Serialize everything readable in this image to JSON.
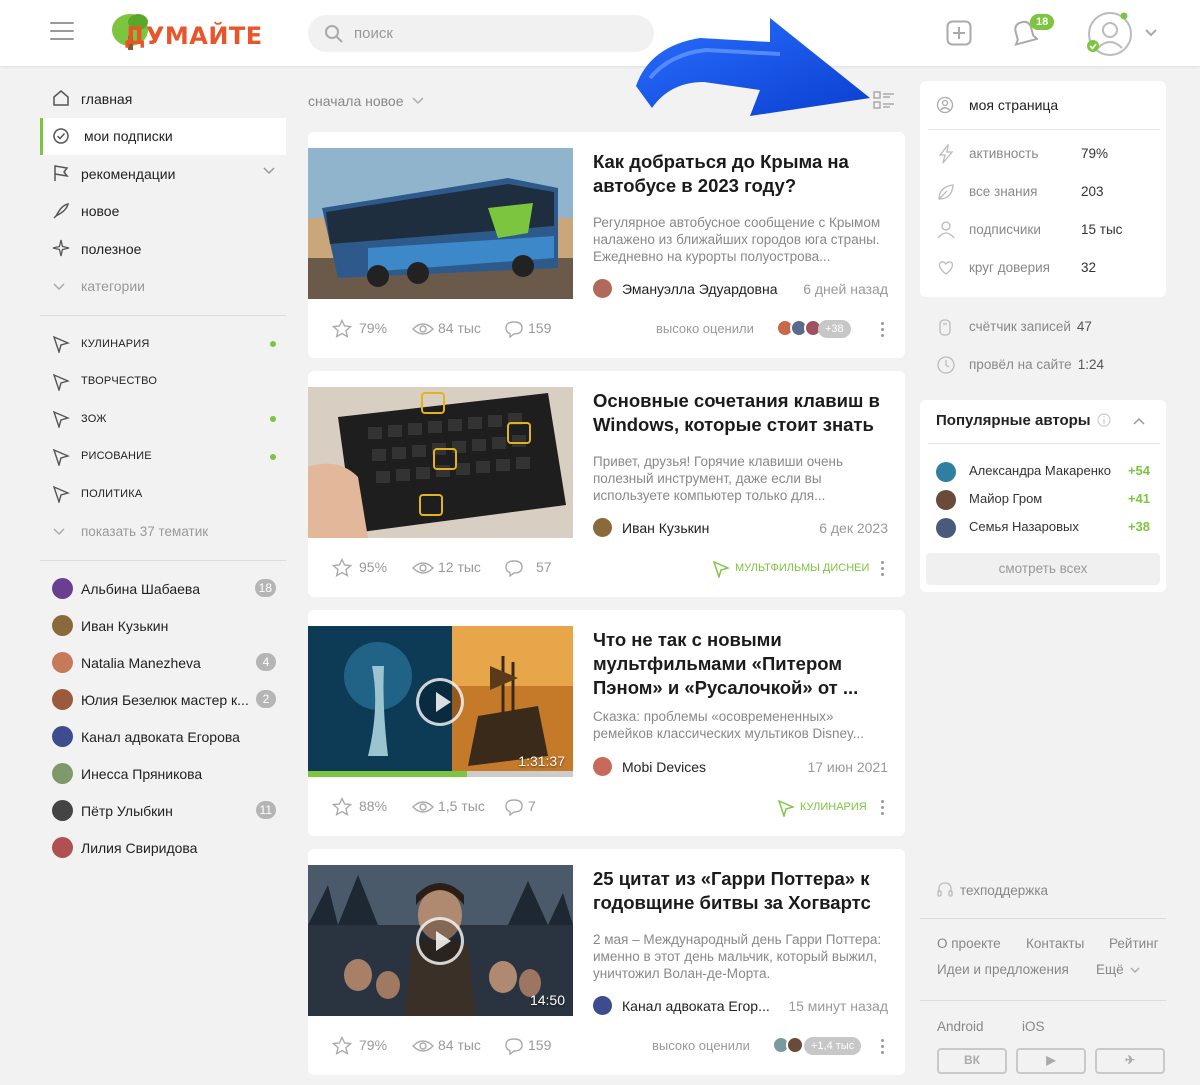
{
  "header": {
    "logo_text": "ДУМАЙТЕ",
    "search_placeholder": "поиск",
    "notifications_count": "18"
  },
  "feed": {
    "sort_label": "сначала новое"
  },
  "sidebar": {
    "nav": [
      {
        "label": "главная",
        "icon": "home-icon"
      },
      {
        "label": "мои подписки",
        "icon": "check-circle-icon"
      },
      {
        "label": "рекомендации",
        "icon": "flag-icon"
      },
      {
        "label": "новое",
        "icon": "rocket-icon"
      },
      {
        "label": "полезное",
        "icon": "sparkle-icon"
      },
      {
        "label": "категории",
        "icon": "chevron-down-icon"
      }
    ],
    "topics": [
      {
        "label": "кулинария",
        "dot": true
      },
      {
        "label": "творчество",
        "dot": false
      },
      {
        "label": "зож",
        "dot": true
      },
      {
        "label": "рисование",
        "dot": true
      },
      {
        "label": "политика",
        "dot": false
      }
    ],
    "show_topics": "показать 37 тематик",
    "subscriptions": [
      {
        "name": "Альбина Шабаева",
        "count": "18",
        "color": "#6b3f8f"
      },
      {
        "name": "Иван Кузькин",
        "count": "",
        "color": "#8a6a3a"
      },
      {
        "name": "Natalia Manezheva",
        "count": "4",
        "color": "#c77a5a"
      },
      {
        "name": "Юлия Безелюк мастер к...",
        "count": "2",
        "color": "#9b5a3c"
      },
      {
        "name": "Канал адвоката Егорова",
        "count": "",
        "color": "#3c4c8f"
      },
      {
        "name": "Инесса Пряникова",
        "count": "",
        "color": "#7f9a6a"
      },
      {
        "name": "Пётр Улыбкин",
        "count": "11",
        "color": "#444444"
      },
      {
        "name": "Лилия Свиридова",
        "count": "",
        "color": "#b05050"
      }
    ]
  },
  "cards": [
    {
      "title": "Как добраться до Крыма на автобусе в 2023 году?",
      "excerpt": "Регулярное автобусное сообщение с Крымом налажено из ближайших городов юга страны. Ежедневно на курорты полуострова...",
      "author": "Эмануэлла Эдуардовна",
      "time": "6 дней назад",
      "rating": "79%",
      "views": "84 тыс",
      "comments": "159",
      "rated_label": "высоко оценили",
      "rated_more": "+38",
      "tag": ""
    },
    {
      "title": "Основные сочетания клавиш в Windows, которые стоит знать",
      "excerpt": "Привет, друзья! Горячие клавиши очень полезный инструмент, даже если вы используете компьютер только для...",
      "author": "Иван Кузькин",
      "time": "6 дек 2023",
      "rating": "95%",
      "views": "12 тыс",
      "comments": "57",
      "tag": "мультфильмы диснеи"
    },
    {
      "title": "Что не так с новыми мультфильмами «Питером Пэном» и «Русалочкой» от ...",
      "excerpt": "Сказка: проблемы «осовремененных» ремейков классических мультиков Disney...",
      "author": "Mobi Devices",
      "time": "17 июн 2021",
      "rating": "88%",
      "views": "1,5 тыс",
      "comments": "7",
      "tag": "кулинария",
      "duration": "1:31:37",
      "progress": 0.6
    },
    {
      "title": "25 цитат из «Гарри Поттера» к годовщине битвы за Хогвартс",
      "excerpt": "2 мая – Международный день Гарри Поттера: именно в этот день мальчик, который выжил, уничтожил Волан-де-Морта.",
      "author": "Канал адвоката Егор...",
      "time": "15 минут назад",
      "rating": "79%",
      "views": "84 тыс",
      "comments": "159",
      "rated_label": "высоко оценили",
      "rated_more": "+1,4 тыс",
      "duration": "14:50"
    }
  ],
  "right": {
    "my_page": "моя страница",
    "stats": [
      {
        "label": "активность",
        "value": "79%",
        "icon": "lightning-icon"
      },
      {
        "label": "все знания",
        "value": "203",
        "icon": "leaf-icon"
      },
      {
        "label": "подписчики",
        "value": "15 тыс",
        "icon": "person-icon"
      },
      {
        "label": "круг доверия",
        "value": "32",
        "icon": "heart-hands-icon"
      }
    ],
    "posts_counter_label": "счётчик записей",
    "posts_counter_value": "47",
    "time_on_site_label": "провёл на сайте",
    "time_on_site_value": "1:24",
    "popular_title": "Популярные авторы",
    "popular": [
      {
        "name": "Александра Макаренко",
        "points": "+54",
        "color": "#2f7fa0"
      },
      {
        "name": "Майор Гром",
        "points": "+41",
        "color": "#6a4a3a"
      },
      {
        "name": "Семья Назаровых",
        "points": "+38",
        "color": "#4a5a7a"
      }
    ],
    "see_all": "смотреть всех",
    "support": "техподдержка",
    "links": [
      "О проекте",
      "Контакты",
      "Рейтинг",
      "Идеи и предложения",
      "Ещё"
    ],
    "apps": [
      "Android",
      "iOS"
    ],
    "social": [
      "ВК",
      "▶",
      "✈"
    ]
  }
}
